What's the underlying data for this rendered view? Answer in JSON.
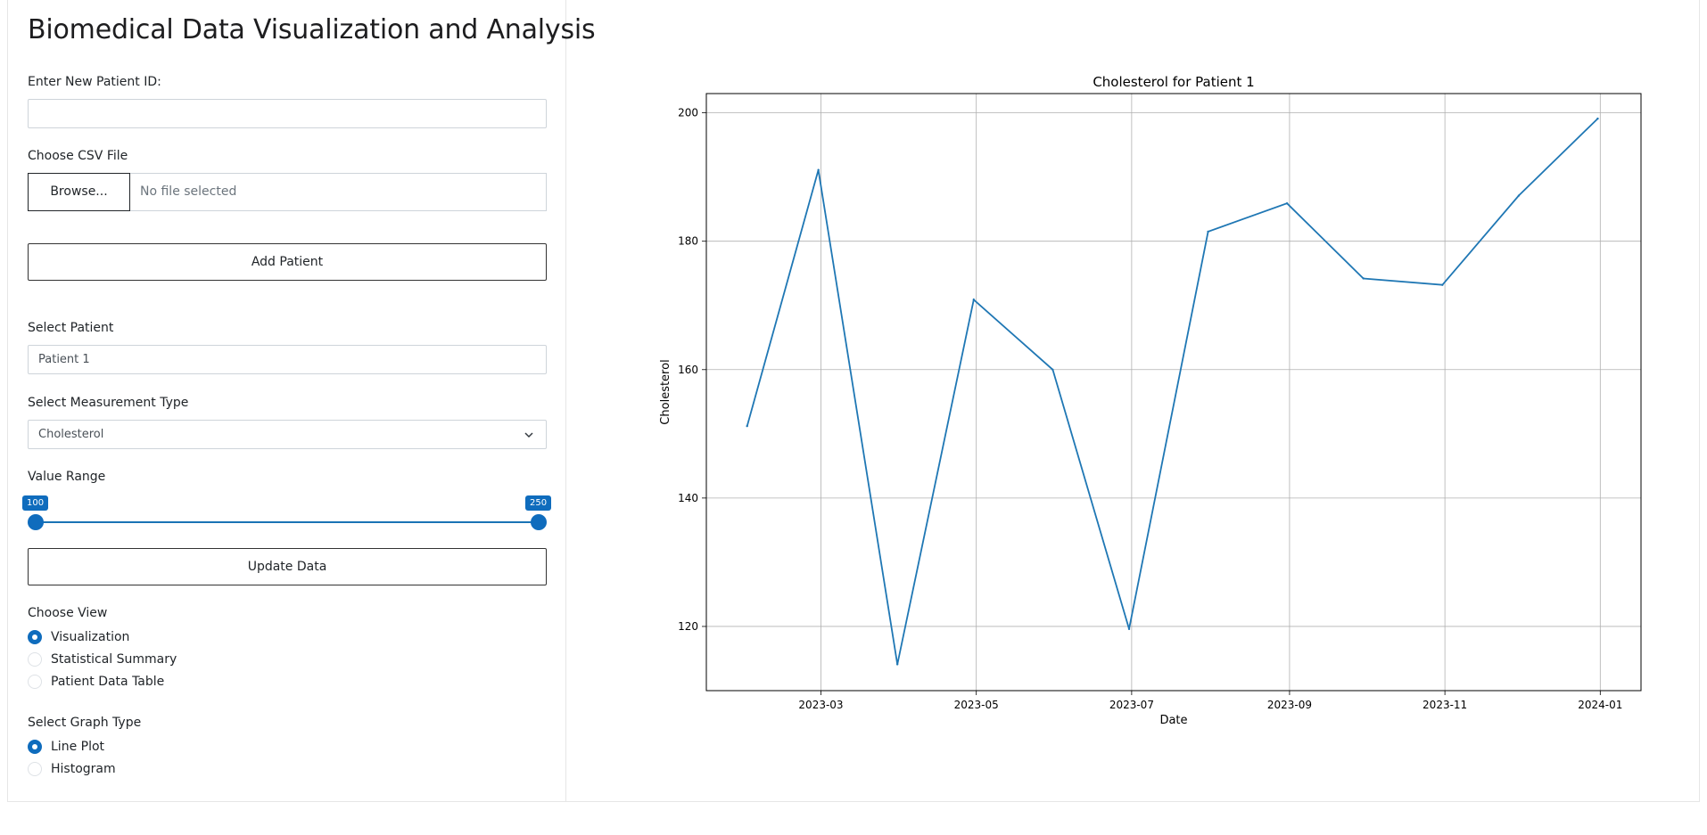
{
  "title": "Biomedical Data Visualization and Analysis",
  "new_patient": {
    "label": "Enter New Patient ID:",
    "value": ""
  },
  "csv": {
    "label": "Choose CSV File",
    "browse_label": "Browse...",
    "status": "No file selected"
  },
  "add_patient_label": "Add Patient",
  "select_patient": {
    "label": "Select Patient",
    "value": "Patient 1"
  },
  "measurement": {
    "label": "Select Measurement Type",
    "value": "Cholesterol"
  },
  "value_range": {
    "label": "Value Range",
    "min": 100,
    "max": 250,
    "min_label": "100",
    "max_label": "250"
  },
  "update_label": "Update Data",
  "choose_view": {
    "label": "Choose View",
    "options": [
      "Visualization",
      "Statistical Summary",
      "Patient Data Table"
    ],
    "selected": 0
  },
  "graph_type": {
    "label": "Select Graph Type",
    "options": [
      "Line Plot",
      "Histogram"
    ],
    "selected": 0
  },
  "colors": {
    "accent": "#0f6cbd",
    "series": "#1f77b4"
  },
  "chart_data": {
    "type": "line",
    "title": "Cholesterol for Patient 1",
    "xlabel": "Date",
    "ylabel": "Cholesterol",
    "x": [
      "2023-01-31",
      "2023-02-28",
      "2023-03-31",
      "2023-04-30",
      "2023-05-31",
      "2023-06-30",
      "2023-07-31",
      "2023-08-31",
      "2023-09-30",
      "2023-10-31",
      "2023-11-30",
      "2023-12-31"
    ],
    "y": [
      151.2,
      191.1,
      114.1,
      170.9,
      160.0,
      119.6,
      181.5,
      185.9,
      174.2,
      173.2,
      187.1,
      199.1
    ],
    "xticks": [
      "2023-03",
      "2023-05",
      "2023-07",
      "2023-09",
      "2023-11",
      "2024-01"
    ],
    "xtick_dates": [
      "2023-03-01",
      "2023-05-01",
      "2023-07-01",
      "2023-09-01",
      "2023-11-01",
      "2024-01-01"
    ],
    "yticks": [
      120,
      140,
      160,
      180,
      200
    ],
    "xlim": [
      "2023-01-15",
      "2024-01-17"
    ],
    "ylim": [
      110,
      203
    ],
    "grid": true,
    "color": "#1f77b4"
  }
}
